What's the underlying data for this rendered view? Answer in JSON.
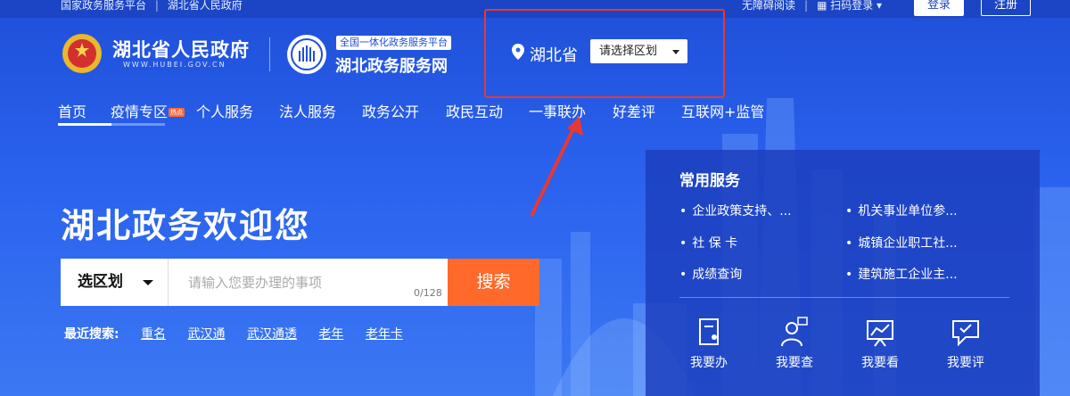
{
  "topbar": {
    "links": [
      "国家政务服务平台",
      "湖北省人民政府"
    ],
    "accessibility": "无障碍阅读",
    "scan_login": "扫码登录",
    "login": "登录",
    "register": "注册"
  },
  "header": {
    "gov_title": "湖北省人民政府",
    "gov_sub": "WWW.HUBEI.GOV.CN",
    "platform_badge": "全国一体化政务服务平台",
    "platform_title": "湖北政务服务网"
  },
  "region": {
    "province": "湖北省",
    "select_label": "请选择区划"
  },
  "nav": {
    "items": [
      "首页",
      "疫情专区",
      "个人服务",
      "法人服务",
      "政务公开",
      "政民互动",
      "一事联办",
      "好差评",
      "互联网+监管"
    ],
    "hot_badge": "热点"
  },
  "hero": {
    "welcome": "湖北政务欢迎您",
    "region_select": "选区划",
    "search_placeholder": "请输入您要办理的事项",
    "counter": "0/128",
    "search_button": "搜索",
    "recent_label": "最近搜索:",
    "recent": [
      "重名",
      "武汉通",
      "武汉通透",
      "老年",
      "老年卡"
    ]
  },
  "panel": {
    "title": "常用服务",
    "services": [
      "企业政策支持、...",
      "机关事业单位参...",
      "社 保 卡",
      "城镇企业职工社...",
      "成绩查询",
      "建筑施工企业主..."
    ],
    "quick": [
      "我要办",
      "我要查",
      "我要看",
      "我要评"
    ]
  },
  "colors": {
    "bg": "#2a62ee",
    "accent": "#ff6a2a",
    "highlight_box": "#e53935"
  }
}
